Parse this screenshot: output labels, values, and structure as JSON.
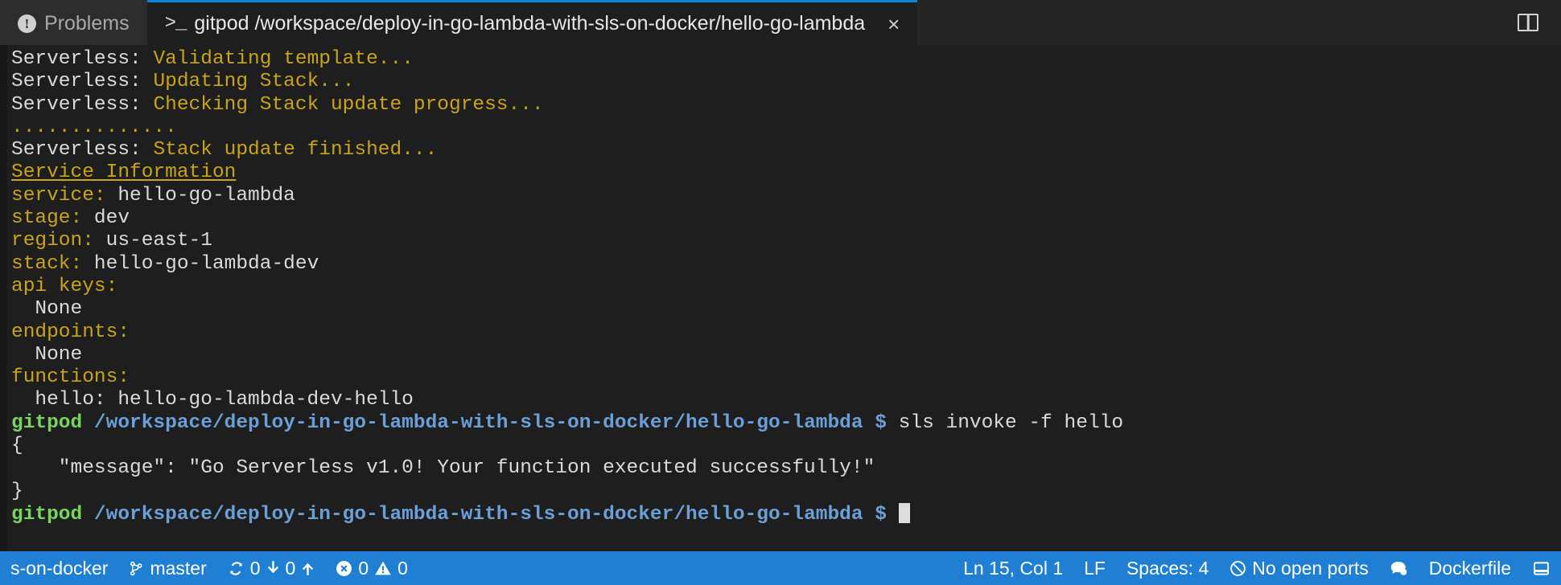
{
  "window": {
    "title": "gitpod terminal panel"
  },
  "tabbar": {
    "tabs": [
      {
        "id": "problems",
        "label": "Problems",
        "icon": "error-circle-icon",
        "active": false,
        "closable": false
      },
      {
        "id": "terminal",
        "label": "gitpod /workspace/deploy-in-go-lambda-with-sls-on-docker/hello-go-lambda",
        "icon": "terminal-prompt-icon",
        "active": true,
        "closable": true,
        "close_label": "×"
      }
    ],
    "problems_icon_glyph": "!",
    "terminal_icon_glyph": ">_",
    "actions": [
      {
        "id": "split",
        "name": "split-terminal-icon",
        "tooltip": "Split Terminal"
      }
    ]
  },
  "terminal": {
    "prompt": {
      "user": "gitpod",
      "path": "/workspace/deploy-in-go-lambda-with-sls-on-docker/hello-go-lambda",
      "symbol": "$"
    },
    "lines": [
      {
        "segments": [
          {
            "text": "Serverless: ",
            "color": "white"
          },
          {
            "text": "Validating template...",
            "color": "yellow"
          }
        ]
      },
      {
        "segments": [
          {
            "text": "Serverless: ",
            "color": "white"
          },
          {
            "text": "Updating Stack...",
            "color": "yellow"
          }
        ]
      },
      {
        "segments": [
          {
            "text": "Serverless: ",
            "color": "white"
          },
          {
            "text": "Checking Stack update progress...",
            "color": "yellow"
          }
        ]
      },
      {
        "segments": [
          {
            "text": "..............",
            "color": "yellow"
          }
        ]
      },
      {
        "segments": [
          {
            "text": "Serverless: ",
            "color": "white"
          },
          {
            "text": "Stack update finished...",
            "color": "yellow"
          }
        ]
      },
      {
        "segments": [
          {
            "text": "Service Information",
            "color": "yellow-underline"
          }
        ]
      },
      {
        "segments": [
          {
            "text": "service: ",
            "color": "yellow"
          },
          {
            "text": "hello-go-lambda",
            "color": "white"
          }
        ]
      },
      {
        "segments": [
          {
            "text": "stage: ",
            "color": "yellow"
          },
          {
            "text": "dev",
            "color": "white"
          }
        ]
      },
      {
        "segments": [
          {
            "text": "region: ",
            "color": "yellow"
          },
          {
            "text": "us-east-1",
            "color": "white"
          }
        ]
      },
      {
        "segments": [
          {
            "text": "stack: ",
            "color": "yellow"
          },
          {
            "text": "hello-go-lambda-dev",
            "color": "white"
          }
        ]
      },
      {
        "segments": [
          {
            "text": "api keys:",
            "color": "yellow"
          }
        ]
      },
      {
        "segments": [
          {
            "text": "  None",
            "color": "white"
          }
        ]
      },
      {
        "segments": [
          {
            "text": "endpoints:",
            "color": "yellow"
          }
        ]
      },
      {
        "segments": [
          {
            "text": "  None",
            "color": "white"
          }
        ]
      },
      {
        "segments": [
          {
            "text": "functions:",
            "color": "yellow"
          }
        ]
      },
      {
        "segments": [
          {
            "text": "  hello: hello-go-lambda-dev-hello",
            "color": "white"
          }
        ]
      },
      {
        "segments": [
          {
            "text": "gitpod",
            "color": "green"
          },
          {
            "text": " ",
            "color": "white"
          },
          {
            "text": "/workspace/deploy-in-go-lambda-with-sls-on-docker/hello-go-lambda",
            "color": "blue"
          },
          {
            "text": " ",
            "color": "white"
          },
          {
            "text": "$",
            "color": "dollar"
          },
          {
            "text": " sls invoke -f hello",
            "color": "white"
          }
        ]
      },
      {
        "segments": [
          {
            "text": "{",
            "color": "white"
          }
        ]
      },
      {
        "segments": [
          {
            "text": "    \"message\": \"Go Serverless v1.0! Your function executed successfully!\"",
            "color": "white"
          }
        ]
      },
      {
        "segments": [
          {
            "text": "}",
            "color": "white"
          }
        ]
      },
      {
        "segments": [
          {
            "text": "gitpod",
            "color": "green"
          },
          {
            "text": " ",
            "color": "white"
          },
          {
            "text": "/workspace/deploy-in-go-lambda-with-sls-on-docker/hello-go-lambda",
            "color": "blue"
          },
          {
            "text": " ",
            "color": "white"
          },
          {
            "text": "$",
            "color": "dollar"
          },
          {
            "text": " ",
            "color": "white"
          },
          {
            "text": "",
            "color": "cursor"
          }
        ]
      }
    ]
  },
  "statusbar": {
    "background": "#1e7fd4",
    "foreground": "#ffffff",
    "left": [
      {
        "id": "remote",
        "name": "remote-workspace-indicator",
        "label": "s-on-docker",
        "icon": null
      },
      {
        "id": "branch",
        "name": "git-branch-status",
        "label": "master",
        "icon": "source-control-branch-icon"
      },
      {
        "id": "sync",
        "name": "git-sync-status",
        "label": "0",
        "icon": "sync-icon",
        "extra_label": "0",
        "extra_icon_down": "arrow-down-icon",
        "extra_icon_up": "arrow-up-icon"
      },
      {
        "id": "problems",
        "name": "problems-status",
        "label": "0",
        "icon": "error-icon",
        "extra_label": "0",
        "extra_icon": "warning-icon"
      }
    ],
    "right": [
      {
        "id": "position",
        "name": "editor-cursor-position",
        "label": "Ln 15, Col 1",
        "icon": null
      },
      {
        "id": "eol",
        "name": "editor-eol-selector",
        "label": "LF",
        "icon": null
      },
      {
        "id": "indent",
        "name": "editor-indentation-selector",
        "label": "Spaces: 4",
        "icon": null
      },
      {
        "id": "ports",
        "name": "open-ports-status",
        "label": "No open ports",
        "icon": "no-ports-icon"
      },
      {
        "id": "feedback",
        "name": "feedback-status",
        "label": "",
        "icon": "feedback-smiley-icon"
      },
      {
        "id": "language",
        "name": "editor-language-selector",
        "label": "Dockerfile",
        "icon": null
      },
      {
        "id": "notifications",
        "name": "notifications-bell-icon",
        "label": "",
        "icon": "panel-layout-icon"
      }
    ],
    "sync_counts": {
      "incoming": "0",
      "outgoing": "0"
    },
    "problem_counts": {
      "errors": "0",
      "warnings": "0"
    }
  },
  "colors": {
    "terminal_bg": "#1e1e1e",
    "tab_inactive_bg": "#2d2d2d",
    "tab_active_border": "#0a84d8",
    "accent_yellow": "#c8a417",
    "accent_green": "#79d45e",
    "accent_blue": "#6a9fd8",
    "statusbar_blue": "#1e7fd4"
  }
}
